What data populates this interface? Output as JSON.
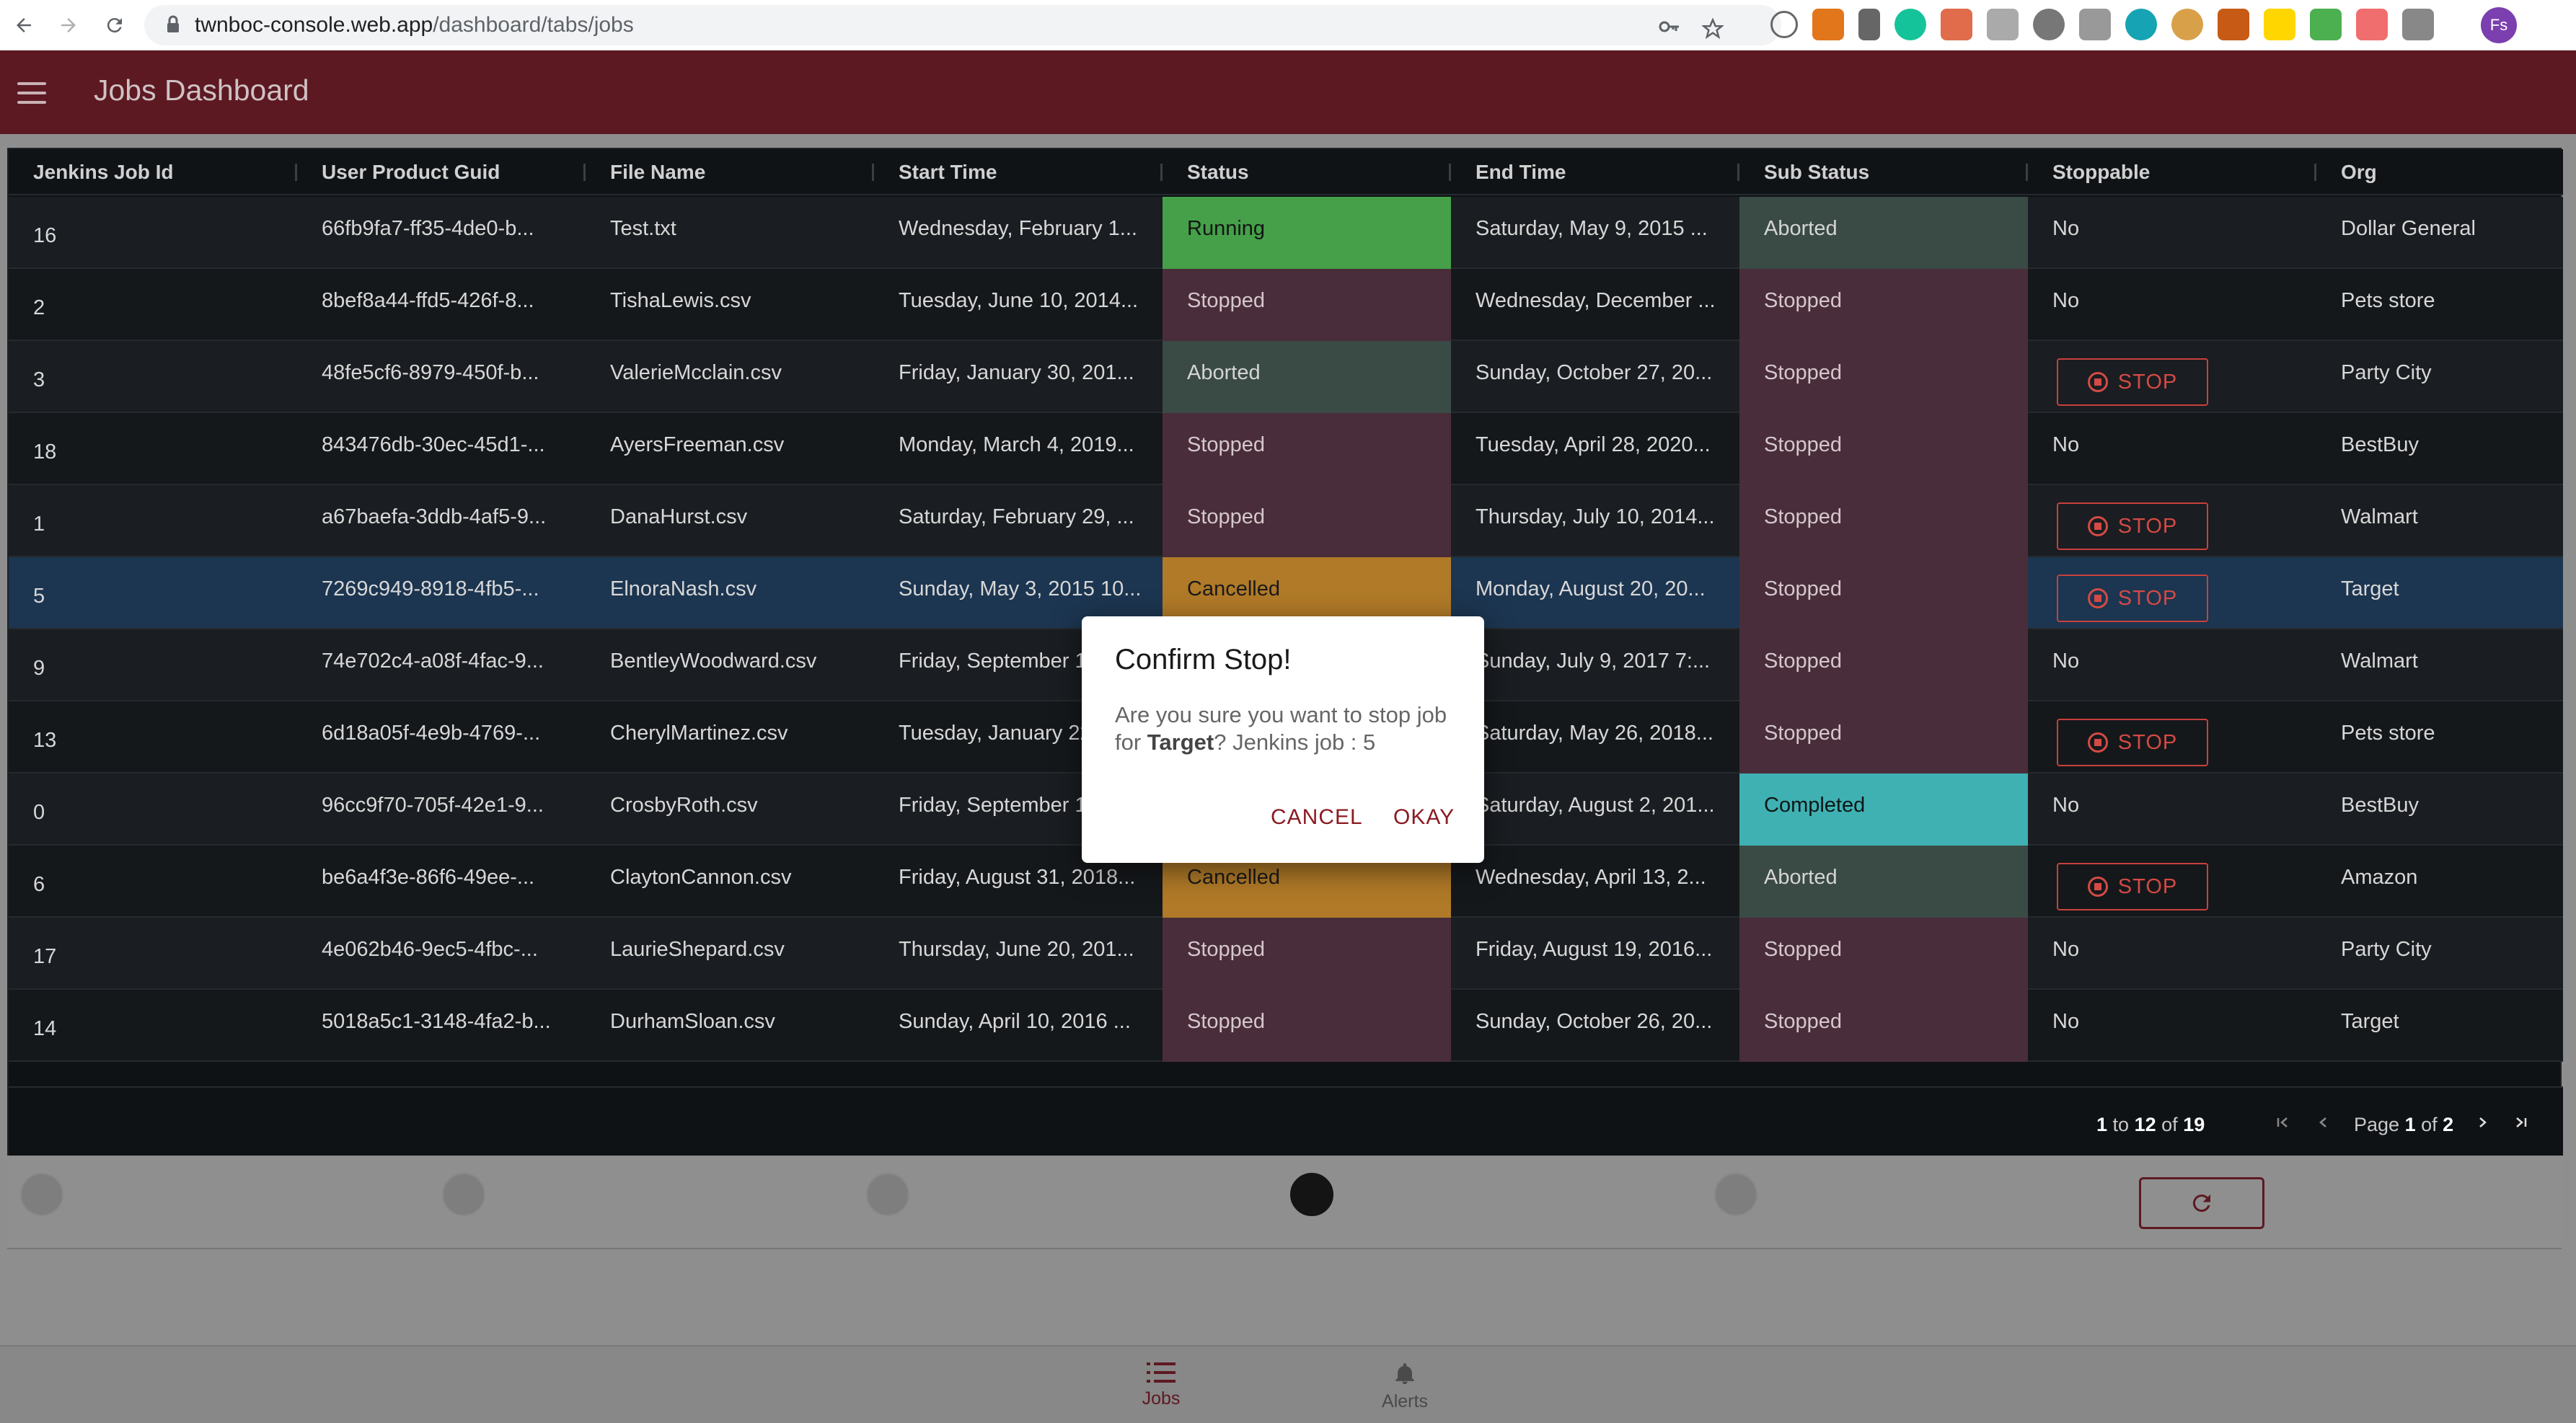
{
  "browser": {
    "url_host": "twnboc-console.web.app",
    "url_path": "/dashboard/tabs/jobs",
    "profile_initials": "Fs"
  },
  "header": {
    "title": "Jobs Dashboard"
  },
  "grid": {
    "columns": [
      "Jenkins Job Id",
      "User Product Guid",
      "File Name",
      "Start Time",
      "Status",
      "End Time",
      "Sub Status",
      "Stoppable",
      "Org"
    ],
    "stop_label": "STOP",
    "rows": [
      {
        "id": "16",
        "guid": "66fb9fa7-ff35-4de0-b...",
        "file": "Test.txt",
        "start": "Wednesday, February 1...",
        "status": "Running",
        "end": "Saturday, May 9, 2015 ...",
        "sub": "Aborted",
        "stoppable": "No",
        "org": "Dollar General"
      },
      {
        "id": "2",
        "guid": "8bef8a44-ffd5-426f-8...",
        "file": "TishaLewis.csv",
        "start": "Tuesday, June 10, 2014...",
        "status": "Stopped",
        "end": "Wednesday, December ...",
        "sub": "Stopped",
        "stoppable": "No",
        "org": "Pets store"
      },
      {
        "id": "3",
        "guid": "48fe5cf6-8979-450f-b...",
        "file": "ValerieMcclain.csv",
        "start": "Friday, January 30, 201...",
        "status": "Aborted",
        "end": "Sunday, October 27, 20...",
        "sub": "Stopped",
        "stoppable": "STOP",
        "org": "Party City"
      },
      {
        "id": "18",
        "guid": "843476db-30ec-45d1-...",
        "file": "AyersFreeman.csv",
        "start": "Monday, March 4, 2019...",
        "status": "Stopped",
        "end": "Tuesday, April 28, 2020...",
        "sub": "Stopped",
        "stoppable": "No",
        "org": "BestBuy"
      },
      {
        "id": "1",
        "guid": "a67baefa-3ddb-4af5-9...",
        "file": "DanaHurst.csv",
        "start": "Saturday, February 29, ...",
        "status": "Stopped",
        "end": "Thursday, July 10, 2014...",
        "sub": "Stopped",
        "stoppable": "STOP",
        "org": "Walmart"
      },
      {
        "id": "5",
        "guid": "7269c949-8918-4fb5-...",
        "file": "ElnoraNash.csv",
        "start": "Sunday, May 3, 2015 10...",
        "status": "Cancelled",
        "end": "Monday, August 20, 20...",
        "sub": "Stopped",
        "stoppable": "STOP",
        "org": "Target"
      },
      {
        "id": "9",
        "guid": "74e702c4-a08f-4fac-9...",
        "file": "BentleyWoodward.csv",
        "start": "Friday, September 1",
        "status": "",
        "end": "Sunday, July 9, 2017 7:...",
        "sub": "Stopped",
        "stoppable": "No",
        "org": "Walmart"
      },
      {
        "id": "13",
        "guid": "6d18a05f-4e9b-4769-...",
        "file": "CherylMartinez.csv",
        "start": "Tuesday, January 22",
        "status": "",
        "end": "Saturday, May 26, 2018...",
        "sub": "Stopped",
        "stoppable": "STOP",
        "org": "Pets store"
      },
      {
        "id": "0",
        "guid": "96cc9f70-705f-42e1-9...",
        "file": "CrosbyRoth.csv",
        "start": "Friday, September 1",
        "status": "",
        "end": "Saturday, August 2, 201...",
        "sub": "Completed",
        "stoppable": "No",
        "org": "BestBuy"
      },
      {
        "id": "6",
        "guid": "be6a4f3e-86f6-49ee-...",
        "file": "ClaytonCannon.csv",
        "start": "Friday, August 31, 2018...",
        "status": "Cancelled",
        "end": "Wednesday, April 13, 2...",
        "sub": "Aborted",
        "stoppable": "STOP",
        "org": "Amazon"
      },
      {
        "id": "17",
        "guid": "4e062b46-9ec5-4fbc-...",
        "file": "LaurieShepard.csv",
        "start": "Thursday, June 20, 201...",
        "status": "Stopped",
        "end": "Friday, August 19, 2016...",
        "sub": "Stopped",
        "stoppable": "No",
        "org": "Party City"
      },
      {
        "id": "14",
        "guid": "5018a5c1-3148-4fa2-b...",
        "file": "DurhamSloan.csv",
        "start": "Sunday, April 10, 2016 ...",
        "status": "Stopped",
        "end": "Sunday, October 26, 20...",
        "sub": "Stopped",
        "stoppable": "No",
        "org": "Target"
      }
    ]
  },
  "pager": {
    "from": "1",
    "to_word": "to",
    "to": "12",
    "of_word": "of",
    "total": "19",
    "page_word": "Page",
    "page": "1",
    "page_of": "of",
    "pages": "2"
  },
  "status_colors": {
    "Running": "#45a049",
    "Stopped": "#4a2d3a",
    "Aborted": "#3a4a44",
    "Cancelled": "#b07a28",
    "Completed": "#3fb1b3"
  },
  "bottom_nav": {
    "jobs_label": "Jobs",
    "alerts_label": "Alerts"
  },
  "dialog": {
    "title": "Confirm Stop!",
    "body_prefix": "Are you sure you want to stop job for ",
    "body_org": "Target",
    "body_suffix": "? Jenkins job : 5",
    "cancel_label": "CANCEL",
    "okay_label": "OKAY"
  },
  "accent_color": "#5d1922"
}
